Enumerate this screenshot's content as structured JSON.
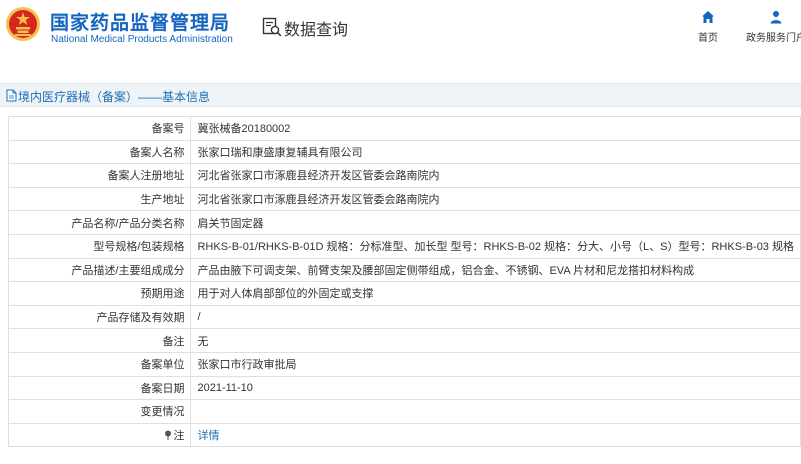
{
  "header": {
    "brand_cn": "国家药品监督管理局",
    "brand_en": "National Medical Products Administration",
    "query_title": "数据查询",
    "nav": {
      "home": "首页",
      "service": "政务服务门户"
    }
  },
  "breadcrumb": "境内医疗器械（备案）——基本信息",
  "rows": [
    {
      "label": "备案号",
      "value": "冀张械备20180002"
    },
    {
      "label": "备案人名称",
      "value": "张家口瑞和康盛康复辅具有限公司"
    },
    {
      "label": "备案人注册地址",
      "value": "河北省张家口市涿鹿县经济开发区管委会路南院内"
    },
    {
      "label": "生产地址",
      "value": "河北省张家口市涿鹿县经济开发区管委会路南院内"
    },
    {
      "label": "产品名称/产品分类名称",
      "value": "肩关节固定器"
    },
    {
      "label": "型号规格/包装规格",
      "value": "RHKS-B-01/RHKS-B-01D 规格：分标准型、加长型 型号：RHKS-B-02 规格：分大、小号（L、S）型号：RHKS-B-03 规格"
    },
    {
      "label": "产品描述/主要组成成分",
      "value": "产品由腋下可调支架、前臂支架及腰部固定侧带组成，铝合金、不锈钢、EVA 片材和尼龙搭扣材料构成"
    },
    {
      "label": "预期用途",
      "value": "用于对人体肩部部位的外固定或支撑"
    },
    {
      "label": "产品存储及有效期",
      "value": "/"
    },
    {
      "label": "备注",
      "value": "无"
    },
    {
      "label": "备案单位",
      "value": "张家口市行政审批局"
    },
    {
      "label": "备案日期",
      "value": "2021-11-10"
    },
    {
      "label": "变更情况",
      "value": ""
    }
  ],
  "note_row": {
    "label": "注",
    "link": "详情"
  },
  "colors": {
    "brand_blue": "#1565c0",
    "link_blue": "#1f6fb2",
    "subbar_bg": "#eef3f8",
    "logo_red": "#d7261e",
    "logo_gold": "#f2c14e"
  }
}
